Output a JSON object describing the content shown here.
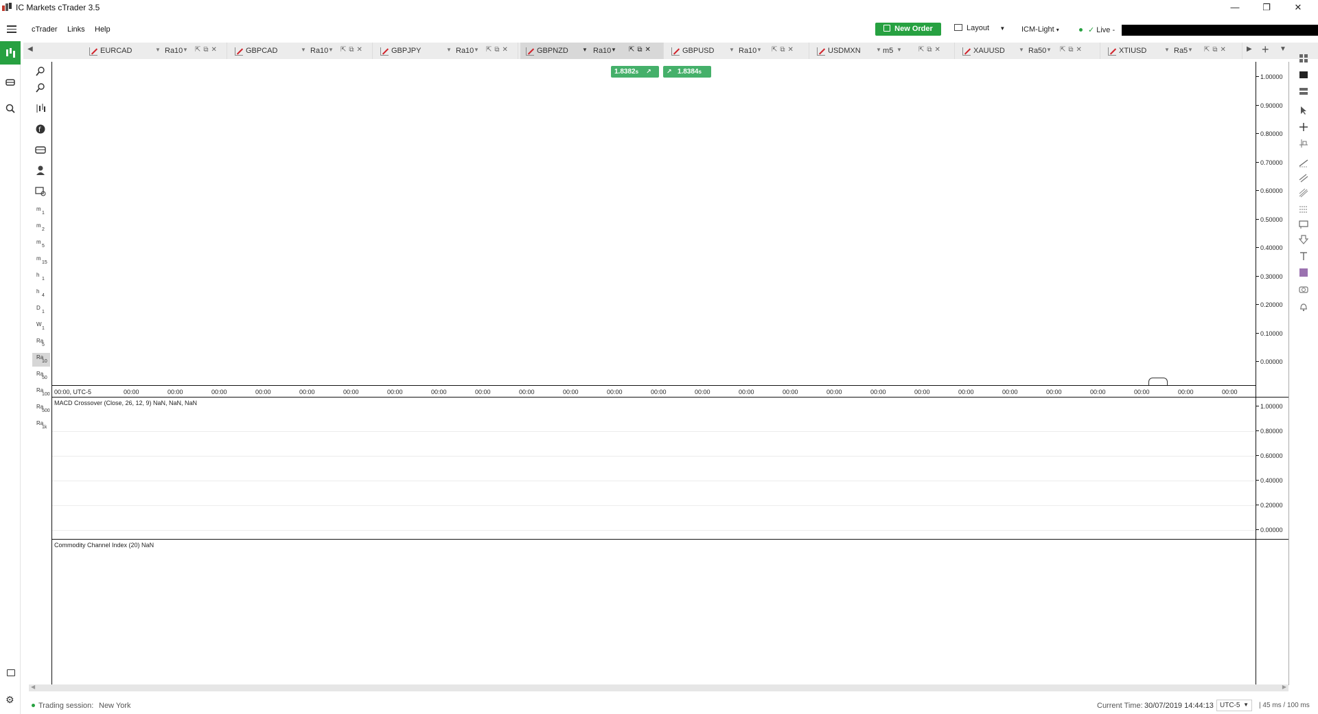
{
  "window": {
    "title": "IC Markets cTrader 3.5",
    "controls": [
      "—",
      "❐",
      "✕"
    ]
  },
  "menu": {
    "items": [
      "cTrader",
      "Links",
      "Help"
    ],
    "new_order": "New Order",
    "layout": "Layout",
    "layout_caret": "▼",
    "theme": "ICM-Light",
    "theme_caret": "▾",
    "live": "Live",
    "live_dash": "-"
  },
  "tabs": [
    {
      "symbol": "EURCAD",
      "timeframe": "Ra10",
      "active": false
    },
    {
      "symbol": "GBPCAD",
      "timeframe": "Ra10",
      "active": false
    },
    {
      "symbol": "GBPJPY",
      "timeframe": "Ra10",
      "active": false
    },
    {
      "symbol": "GBPNZD",
      "timeframe": "Ra10",
      "active": true
    },
    {
      "symbol": "GBPUSD",
      "timeframe": "Ra10",
      "active": false
    },
    {
      "symbol": "USDMXN",
      "timeframe": "m5",
      "active": false
    },
    {
      "symbol": "XAUUSD",
      "timeframe": "Ra50",
      "active": false
    },
    {
      "symbol": "XTIUSD",
      "timeframe": "Ra5",
      "active": false
    }
  ],
  "timeframes": [
    {
      "unit": "m",
      "num": "1"
    },
    {
      "unit": "m",
      "num": "2"
    },
    {
      "unit": "m",
      "num": "5"
    },
    {
      "unit": "m",
      "num": "15"
    },
    {
      "unit": "h",
      "num": "1"
    },
    {
      "unit": "h",
      "num": "4"
    },
    {
      "unit": "D",
      "num": "1"
    },
    {
      "unit": "W",
      "num": "1"
    },
    {
      "unit": "Ra",
      "num": "5"
    },
    {
      "unit": "Ra",
      "num": "10"
    },
    {
      "unit": "Ra",
      "num": "50"
    },
    {
      "unit": "Ra",
      "num": "100"
    },
    {
      "unit": "Ra",
      "num": "500"
    },
    {
      "unit": "Ra",
      "num": "1k"
    }
  ],
  "active_timeframe": "Ra10",
  "quotes": {
    "bid": "1.8382",
    "bid_sup": "s",
    "ask": "1.8384",
    "ask_sup": "s"
  },
  "main_pane": {
    "price_ticks": [
      "1.00000",
      "0.90000",
      "0.80000",
      "0.70000",
      "0.60000",
      "0.50000",
      "0.40000",
      "0.30000",
      "0.20000",
      "0.10000",
      "0.00000"
    ],
    "time_first": "00:00, UTC-5",
    "time_ticks": [
      "00:00",
      "00:00",
      "00:00",
      "00:00",
      "00:00",
      "00:00",
      "00:00",
      "00:00",
      "00:00",
      "00:00",
      "00:00",
      "00:00",
      "00:00",
      "00:00",
      "00:00",
      "00:00",
      "00:00",
      "00:00",
      "00:00",
      "00:00",
      "00:00",
      "00:00",
      "00:00",
      "00:00",
      "00:00",
      "00:00"
    ]
  },
  "macd_pane": {
    "label": "MACD Crossover (Close, 26, 12, 9) NaN, NaN, NaN",
    "price_ticks": [
      "1.00000",
      "0.80000",
      "0.60000",
      "0.40000",
      "0.20000",
      "0.00000"
    ]
  },
  "cci_pane": {
    "label": "Commodity Channel Index (20) NaN"
  },
  "status": {
    "session_label": "Trading session:",
    "session_value": "New York",
    "time_label": "Current Time:",
    "time_value": "30/07/2019 14:44:13",
    "timezone": "UTC-5",
    "latency": "45 ms / 100 ms"
  },
  "colors": {
    "accent": "#27a141",
    "quote": "#45b06a",
    "symbol_icon": "#d0232b"
  }
}
